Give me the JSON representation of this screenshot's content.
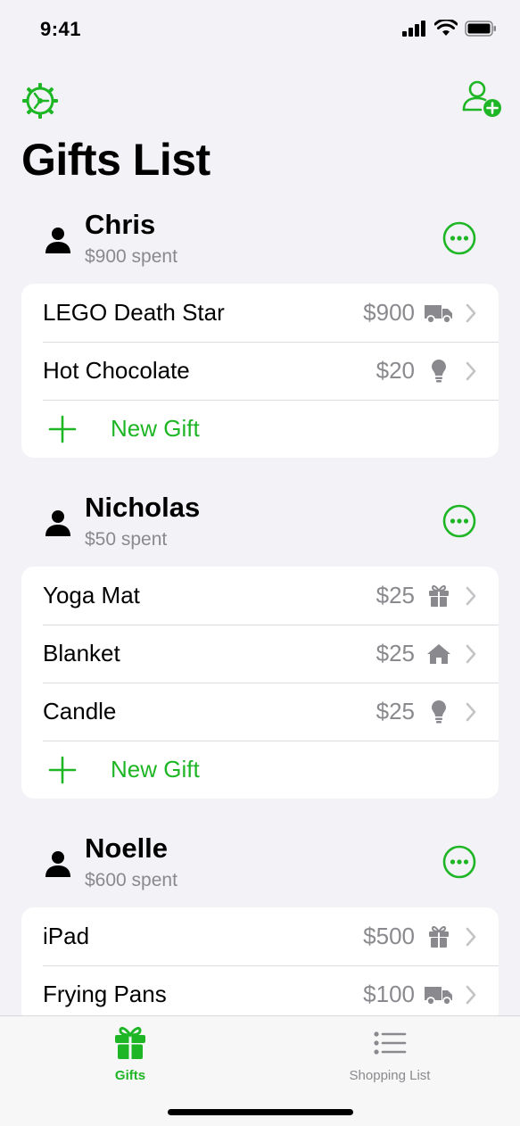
{
  "status_bar": {
    "time": "9:41"
  },
  "header": {
    "title": "Gifts List"
  },
  "colors": {
    "accent": "#1fb626",
    "secondary_text": "#8a8a8e",
    "background": "#f2f2f7"
  },
  "people": [
    {
      "name": "Chris",
      "spent": "$900 spent",
      "gifts": [
        {
          "name": "LEGO Death Star",
          "price": "$900",
          "status_icon": "truck-icon"
        },
        {
          "name": "Hot Chocolate",
          "price": "$20",
          "status_icon": "lightbulb-icon"
        }
      ],
      "new_gift_label": "New Gift"
    },
    {
      "name": "Nicholas",
      "spent": "$50 spent",
      "gifts": [
        {
          "name": "Yoga Mat",
          "price": "$25",
          "status_icon": "gift-icon"
        },
        {
          "name": "Blanket",
          "price": "$25",
          "status_icon": "house-icon"
        },
        {
          "name": "Candle",
          "price": "$25",
          "status_icon": "lightbulb-icon"
        }
      ],
      "new_gift_label": "New Gift"
    },
    {
      "name": "Noelle",
      "spent": "$600 spent",
      "gifts": [
        {
          "name": "iPad",
          "price": "$500",
          "status_icon": "gift-icon"
        },
        {
          "name": "Frying Pans",
          "price": "$100",
          "status_icon": "truck-icon"
        }
      ]
    }
  ],
  "tabbar": {
    "tabs": [
      {
        "label": "Gifts",
        "icon": "gift-icon",
        "selected": true
      },
      {
        "label": "Shopping List",
        "icon": "list-icon",
        "selected": false
      }
    ]
  }
}
